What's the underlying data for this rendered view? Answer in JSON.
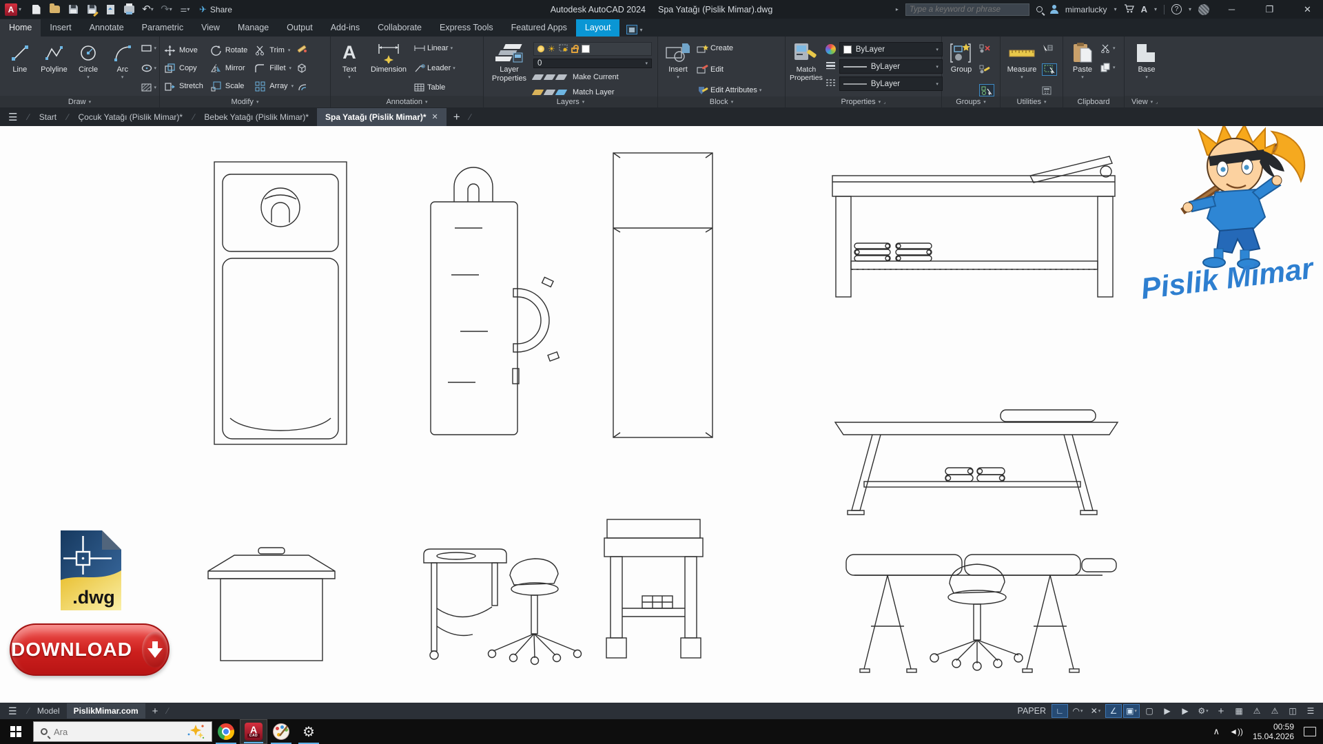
{
  "window": {
    "app_title": "Autodesk AutoCAD 2024",
    "doc_title": "Spa Yatağı (Pislik Mimar).dwg",
    "share": "Share",
    "search_placeholder": "Type a keyword or phrase",
    "user": "mimarlucky"
  },
  "tabs": [
    "Home",
    "Insert",
    "Annotate",
    "Parametric",
    "View",
    "Manage",
    "Output",
    "Add-ins",
    "Collaborate",
    "Express Tools",
    "Featured Apps",
    "Layout"
  ],
  "ribbon": {
    "draw": {
      "title": "Draw",
      "line": "Line",
      "polyline": "Polyline",
      "circle": "Circle",
      "arc": "Arc"
    },
    "modify": {
      "title": "Modify",
      "move": "Move",
      "rotate": "Rotate",
      "trim": "Trim",
      "copy": "Copy",
      "mirror": "Mirror",
      "fillet": "Fillet",
      "stretch": "Stretch",
      "scale": "Scale",
      "array": "Array"
    },
    "annotation": {
      "title": "Annotation",
      "text": "Text",
      "dimension": "Dimension",
      "linear": "Linear",
      "leader": "Leader",
      "table": "Table"
    },
    "layers": {
      "title": "Layers",
      "layer_properties": "Layer Properties",
      "current_layer": "0",
      "make_current": "Make Current",
      "match_layer": "Match Layer"
    },
    "block": {
      "title": "Block",
      "insert": "Insert",
      "create": "Create",
      "edit": "Edit",
      "edit_attributes": "Edit Attributes"
    },
    "properties": {
      "title": "Properties",
      "match_properties": "Match Properties",
      "color": "ByLayer",
      "lineweight": "ByLayer",
      "linetype": "ByLayer"
    },
    "groups": {
      "title": "Groups",
      "group": "Group"
    },
    "utilities": {
      "title": "Utilities",
      "measure": "Measure"
    },
    "clipboard": {
      "title": "Clipboard",
      "paste": "Paste"
    },
    "view": {
      "title": "View",
      "base": "Base"
    }
  },
  "file_tabs": {
    "items": [
      "Start",
      "Çocuk Yatağı (Pislik Mimar)*",
      "Bebek Yatağı (Pislik Mimar)*",
      "Spa Yatağı (Pislik Mimar)*"
    ]
  },
  "content": {
    "brand": "Pislik Mimar",
    "file_badge": ".dwg",
    "download": "DOWNLOAD"
  },
  "status": {
    "model_tab": "Model",
    "layout_tab": "PislikMimar.com",
    "space": "PAPER",
    "icons": [
      {
        "name": "grid-display",
        "g": "∟"
      },
      {
        "name": "snap-mode",
        "g": "◠"
      },
      {
        "name": "dynamic-input",
        "g": "✕"
      },
      {
        "name": "ortho-polar",
        "g": "∠"
      },
      {
        "name": "object-snap",
        "g": "▣"
      },
      {
        "name": "selection-cycling",
        "g": "▢"
      },
      {
        "name": "annotation-visibility",
        "g": "▶"
      },
      {
        "name": "annotation-autoscale",
        "g": "▶"
      },
      {
        "name": "workspace-settings",
        "g": "⚙"
      },
      {
        "name": "quick-properties",
        "g": "+"
      },
      {
        "name": "isolate-objects",
        "g": "▦"
      },
      {
        "name": "graphics-performance",
        "g": "⚠"
      },
      {
        "name": "annotation-monitor",
        "g": "⚠"
      },
      {
        "name": "clean-screen",
        "g": "◫"
      },
      {
        "name": "customization",
        "g": "☰"
      }
    ]
  },
  "taskbar": {
    "search_placeholder": "Ara",
    "time": "00:59",
    "date": "15.04.2026"
  },
  "colors": {
    "autodesk_blue": "#0a96d4",
    "download_red": "#cc1f1d",
    "taskbar_indicator": "#5fb2e8",
    "brand_blue": "#2e7fd0"
  }
}
